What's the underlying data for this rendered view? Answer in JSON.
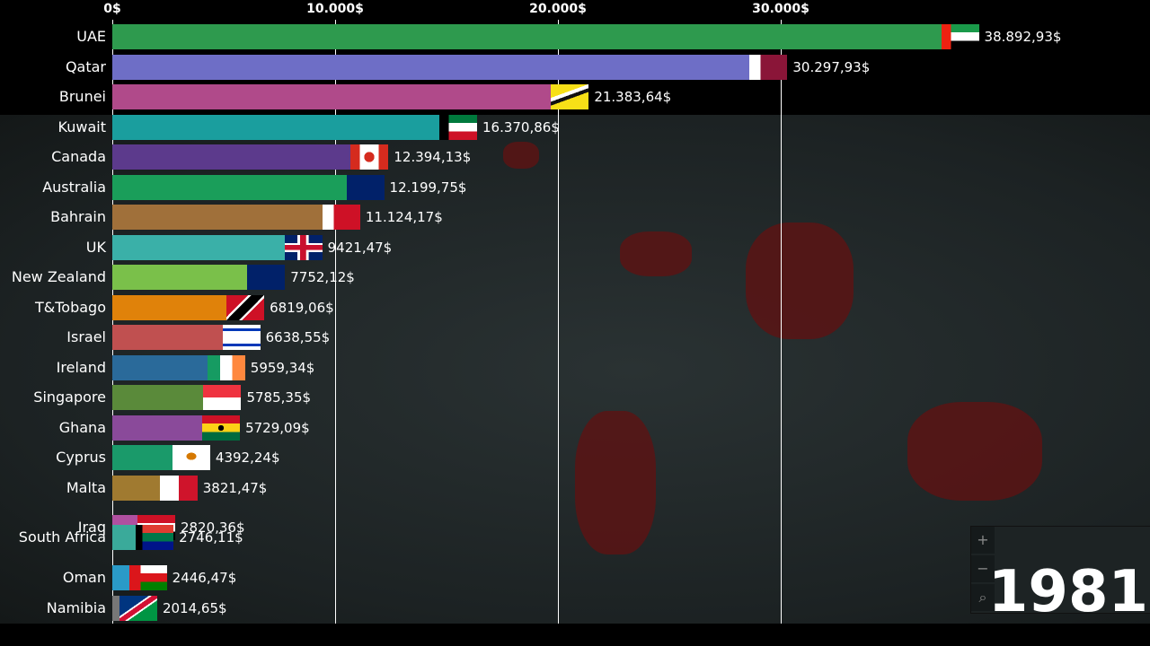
{
  "chart_data": {
    "type": "bar",
    "orientation": "horizontal",
    "title": "",
    "year": "1981",
    "xlim": [
      0,
      39000
    ],
    "x_ticks": [
      {
        "value": 0,
        "label": "0$"
      },
      {
        "value": 10000,
        "label": "10.000$"
      },
      {
        "value": 20000,
        "label": "20.000$"
      },
      {
        "value": 30000,
        "label": "30.000$"
      }
    ],
    "grid": true,
    "bars": [
      {
        "name": "UAE",
        "value": 38892.93,
        "label": "38.892,93$",
        "color": "#2e9a4e",
        "flag": "uae"
      },
      {
        "name": "Qatar",
        "value": 30297.93,
        "label": "30.297,93$",
        "color": "#6e6ec6",
        "flag": "qatar"
      },
      {
        "name": "Brunei",
        "value": 21383.64,
        "label": "21.383,64$",
        "color": "#b04a8a",
        "flag": "brunei"
      },
      {
        "name": "Kuwait",
        "value": 16370.86,
        "label": "16.370,86$",
        "color": "#1a9e9e",
        "flag": "kuwait"
      },
      {
        "name": "Canada",
        "value": 12394.13,
        "label": "12.394,13$",
        "color": "#5c3a8c",
        "flag": "canada"
      },
      {
        "name": "Australia",
        "value": 12199.75,
        "label": "12.199,75$",
        "color": "#1a9e5a",
        "flag": "australia"
      },
      {
        "name": "Bahrain",
        "value": 11124.17,
        "label": "11.124,17$",
        "color": "#a0703a",
        "flag": "bahrain"
      },
      {
        "name": "UK",
        "value": 9421.47,
        "label": "9421,47$",
        "color": "#3ab0a8",
        "flag": "uk"
      },
      {
        "name": "New Zealand",
        "value": 7752.12,
        "label": "7752,12$",
        "color": "#7ac04a",
        "flag": "newzealand"
      },
      {
        "name": "T&Tobago",
        "value": 6819.06,
        "label": "6819,06$",
        "color": "#e0820a",
        "flag": "trinidad"
      },
      {
        "name": "Israel",
        "value": 6638.55,
        "label": "6638,55$",
        "color": "#c05050",
        "flag": "israel"
      },
      {
        "name": "Ireland",
        "value": 5959.34,
        "label": "5959,34$",
        "color": "#2a6a9a",
        "flag": "ireland"
      },
      {
        "name": "Singapore",
        "value": 5785.35,
        "label": "5785,35$",
        "color": "#5a8a3a",
        "flag": "singapore"
      },
      {
        "name": "Ghana",
        "value": 5729.09,
        "label": "5729,09$",
        "color": "#8a4a9a",
        "flag": "ghana"
      },
      {
        "name": "Cyprus",
        "value": 4392.24,
        "label": "4392,24$",
        "color": "#1a9a6a",
        "flag": "cyprus"
      },
      {
        "name": "Malta",
        "value": 3821.47,
        "label": "3821,47$",
        "color": "#a07a30",
        "flag": "malta"
      },
      {
        "name": "Iraq",
        "value": 2820.36,
        "label": "2820,36$",
        "color": "#b050a0",
        "flag": "iraq"
      },
      {
        "name": "South Africa",
        "value": 2746.11,
        "label": "2746,11$",
        "color": "#3aaa9a",
        "flag": "southafrica"
      },
      {
        "name": "Oman",
        "value": 2446.47,
        "label": "2446,47$",
        "color": "#2a9ac8",
        "flag": "oman"
      },
      {
        "name": "Namibia",
        "value": 2014.65,
        "label": "2014,65$",
        "color": "#777777",
        "flag": "namibia"
      }
    ]
  },
  "map_controls": {
    "zoom_in": "+",
    "zoom_out": "−",
    "search": "⌕"
  }
}
